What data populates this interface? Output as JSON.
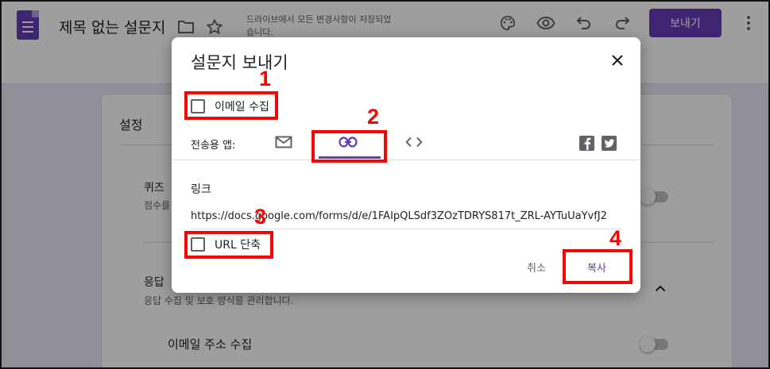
{
  "app": {
    "doc_title": "제목 없는 설문지",
    "save_status": "드라이브에서 모든 변경사항이 저장되었습니다.",
    "send_label": "보내기"
  },
  "settings": {
    "title": "설정",
    "quiz_title": "퀴즈",
    "quiz_sub": "점수를",
    "responses_title": "응답",
    "responses_sub": "응답 수집 및 보호 방식을 관리합니다.",
    "email_collect_title": "이메일 주소 수집"
  },
  "dialog": {
    "title": "설문지 보내기",
    "collect_email_label": "이메일 수집",
    "send_via_label": "전송용 앱:",
    "tabs": [
      "email",
      "link",
      "embed"
    ],
    "active_tab": "link",
    "link_label": "링크",
    "link_url": "https://docs.google.com/forms/d/e/1FAIpQLSdf3ZOzTDRYS817t_ZRL-AYTuUaYvfJ2",
    "shorten_url_label": "URL 단축",
    "cancel_label": "취소",
    "copy_label": "복사"
  },
  "annotations": [
    "1",
    "2",
    "3",
    "4"
  ],
  "colors": {
    "brand": "#673ab7",
    "annotation": "#ff0000"
  },
  "icons": [
    "forms-logo-icon",
    "folder-icon",
    "star-icon",
    "palette-icon",
    "eye-icon",
    "undo-icon",
    "redo-icon",
    "more-vert-icon",
    "close-icon",
    "mail-icon",
    "link-icon",
    "embed-icon",
    "facebook-icon",
    "twitter-icon",
    "chevron-up-icon"
  ]
}
